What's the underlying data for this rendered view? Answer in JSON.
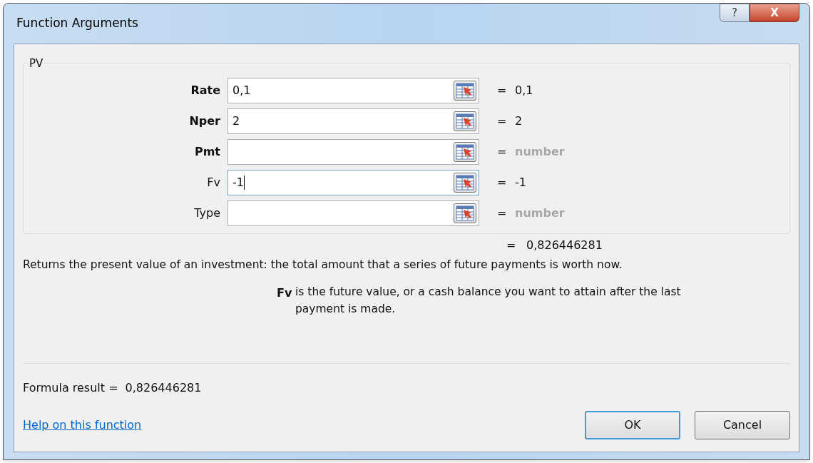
{
  "window": {
    "title": "Function Arguments"
  },
  "title_buttons": [
    {
      "kind": "help",
      "label": "?"
    },
    {
      "kind": "close",
      "label": "X"
    }
  ],
  "group": {
    "title": "PV"
  },
  "arguments": [
    {
      "name": "Rate",
      "required": true,
      "value": "0,1",
      "result": "0,1",
      "result_is_hint": false,
      "focused": false
    },
    {
      "name": "Nper",
      "required": true,
      "value": "2",
      "result": "2",
      "result_is_hint": false,
      "focused": false
    },
    {
      "name": "Pmt",
      "required": true,
      "result": "number",
      "result_is_hint": true,
      "focused": false
    },
    {
      "name": "Fv",
      "required": false,
      "value": "-1",
      "result": "-1",
      "result_is_hint": false,
      "focused": true
    },
    {
      "name": "Type",
      "required": false,
      "result": "number",
      "result_is_hint": true,
      "focused": false
    }
  ],
  "equals_sign": "=",
  "function_result": "0,826446281",
  "description": "Returns the present value of an investment: the total amount that a series of future payments is worth now.",
  "argument_help": {
    "name": "Fv",
    "text": "is the future value, or a cash balance you want to attain after the last payment is made."
  },
  "formula_result": {
    "label": "Formula result =",
    "value": "0,826446281"
  },
  "help_link": "Help on this function",
  "buttons": [
    {
      "label": "OK",
      "default": true
    },
    {
      "label": "Cancel",
      "default": false
    }
  ]
}
